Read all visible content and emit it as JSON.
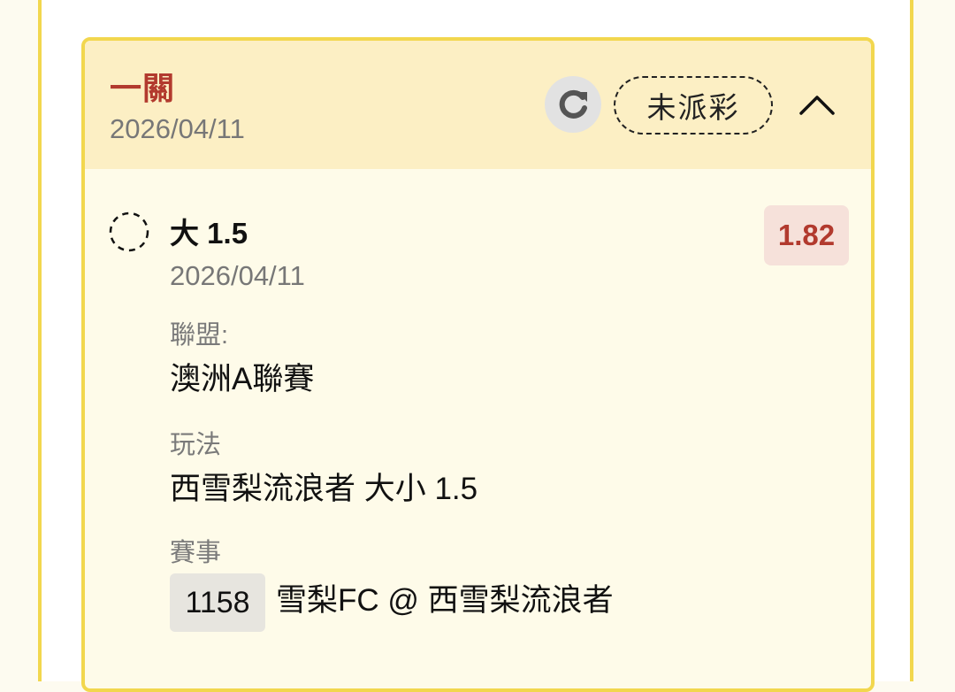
{
  "bet": {
    "type": "一關",
    "date": "2026/04/11",
    "status": "未派彩",
    "icons": {
      "refresh": "refresh-icon",
      "collapse": "chevron-up-icon",
      "selection": "dashed-circle-icon"
    }
  },
  "selection": {
    "title": "大 1.5",
    "date": "2026/04/11",
    "odds": "1.82",
    "league_label": "聯盟:",
    "league_value": "澳洲A聯賽",
    "market_label": "玩法",
    "market_value": "西雪梨流浪者 大小 1.5",
    "event_label": "賽事",
    "event_id": "1158",
    "event_name": "雪梨FC @ 西雪梨流浪者"
  },
  "colors": {
    "accent_red": "#b23a2e",
    "border_yellow": "#f2d74e",
    "header_bg": "#fcefc4",
    "card_bg": "#fefbe9",
    "odds_bg": "#f6e1da"
  }
}
